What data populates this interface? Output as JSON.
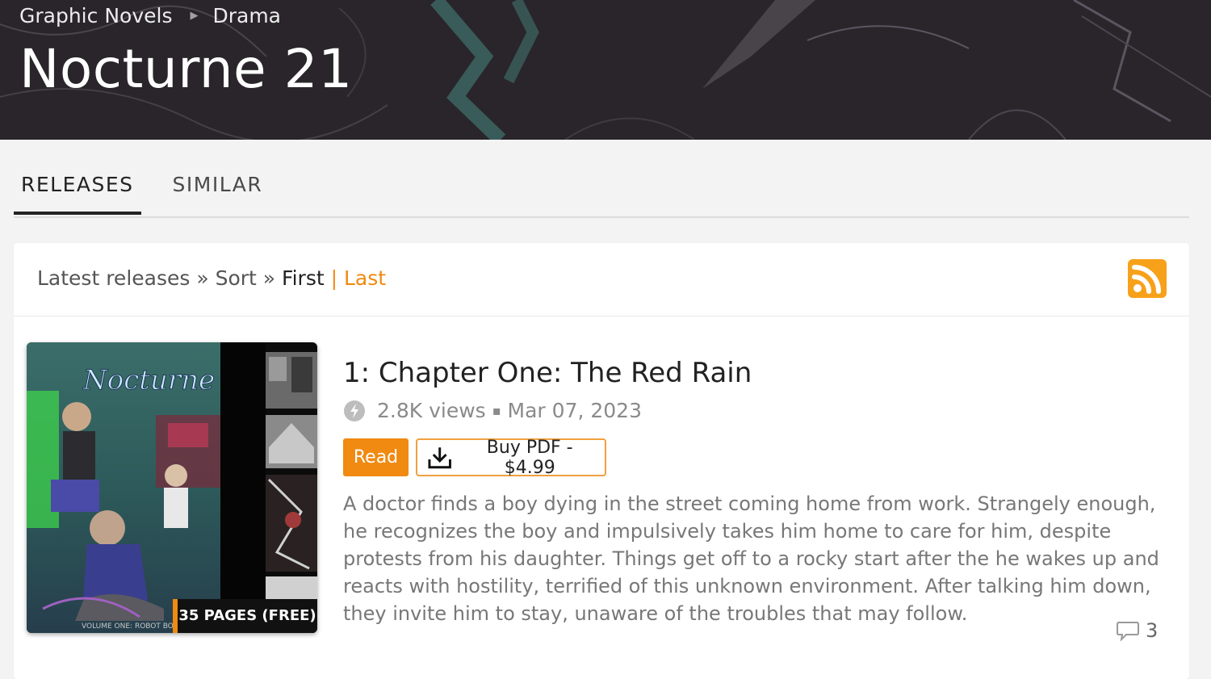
{
  "breadcrumb": [
    "Graphic Novels",
    "Drama"
  ],
  "series_title": "Nocturne 21",
  "tabs": [
    "RELEASES",
    "SIMILAR"
  ],
  "active_tab": "RELEASES",
  "sort": {
    "prefix": "Latest releases » Sort »",
    "first": "First",
    "separator": "|",
    "last": "Last"
  },
  "release": {
    "title": "1: Chapter One: The Red Rain",
    "views": "2.8K views",
    "dot": "▪",
    "date": "Mar 07, 2023",
    "read_label": "Read",
    "buy_label": "Buy PDF - $4.99",
    "pages_badge": "35 PAGES (FREE)",
    "cover_title": "Nocturne 21",
    "cover_subtitle": "VOLUME ONE: ROBOT BOY",
    "description": "A doctor finds a boy dying in the street coming home from work. Strangely enough, he recognizes the boy and impulsively takes him home to care for him, despite protests from his daughter. Things get off to a rocky start after the he wakes up and reacts with hostility, terrified of this unknown environment. After talking him down, they invite him to stay, unaware of the troubles that may follow.",
    "comment_count": "3"
  },
  "icons": {
    "rss": "rss-icon",
    "views": "views-icon",
    "download": "download-icon",
    "comment": "comment-icon",
    "breadcrumb_sep": "chevron-right-icon"
  },
  "colors": {
    "accent": "#f08a10",
    "rss": "#f7a11a",
    "hero_bg": "#2a2629"
  }
}
